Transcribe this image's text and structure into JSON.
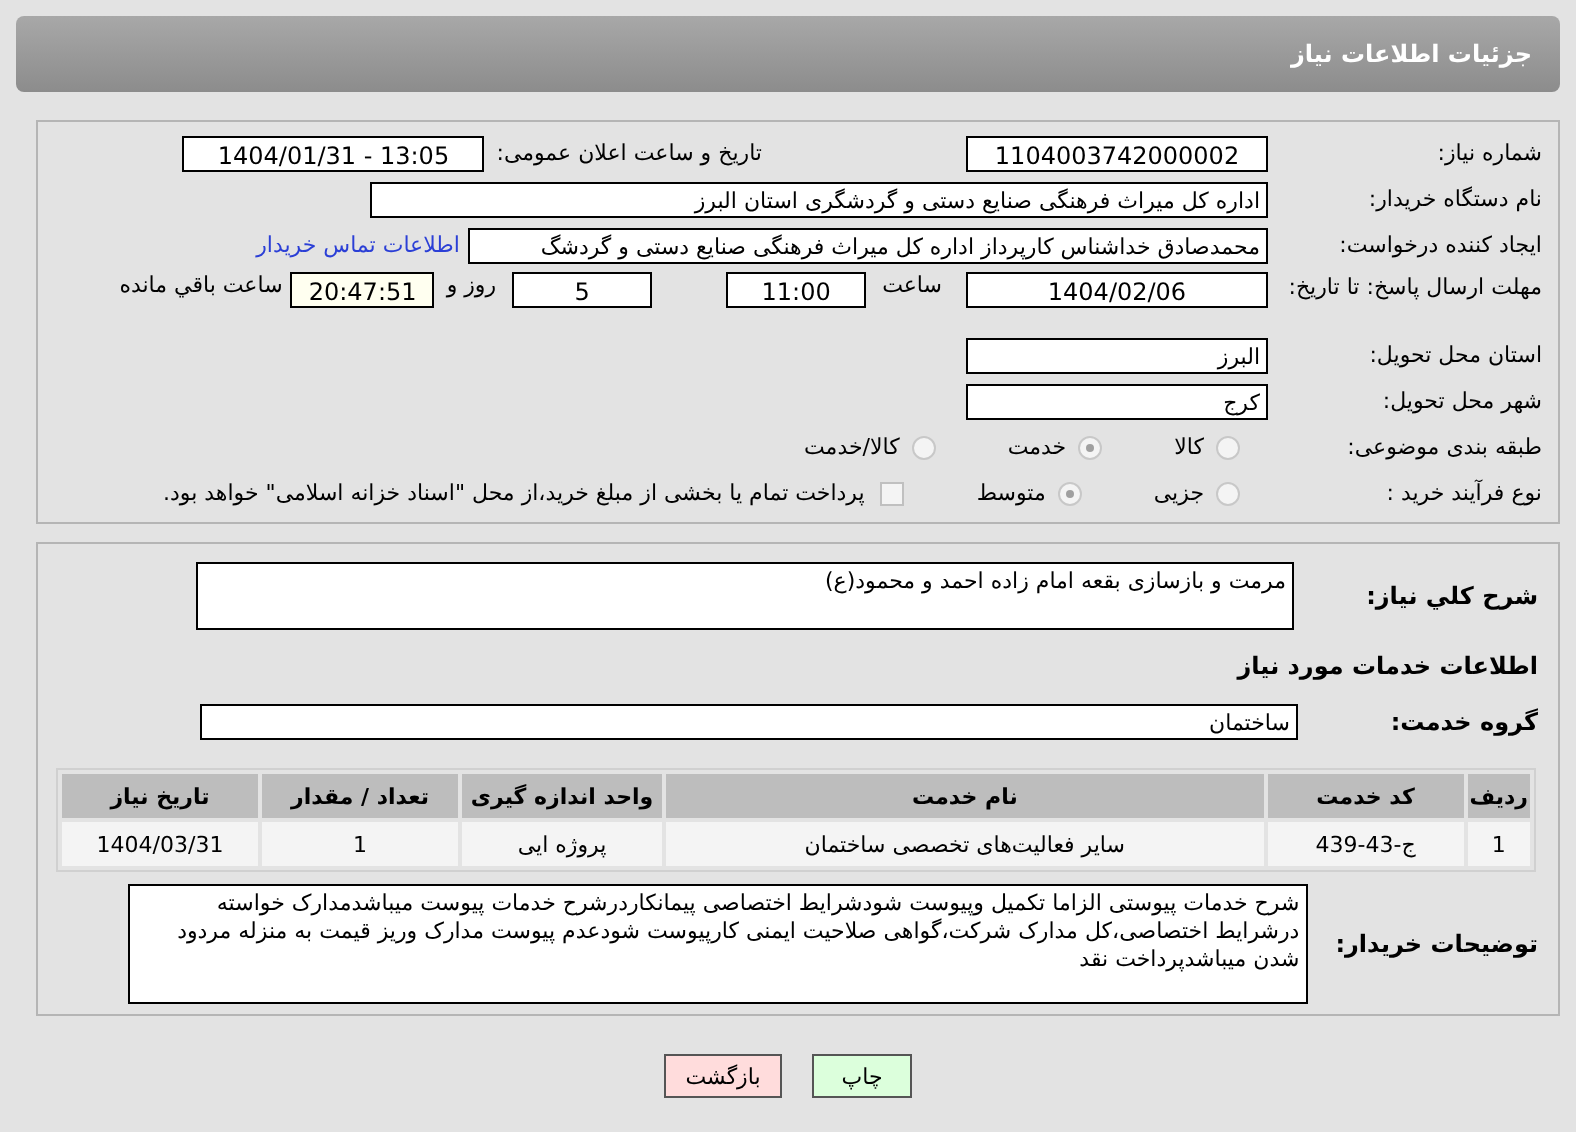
{
  "header": {
    "title": "جزئیات اطلاعات نیاز"
  },
  "details": {
    "need_number": {
      "label": "شماره نیاز:",
      "value": "1104003742000002"
    },
    "announce": {
      "label": "تاریخ و ساعت اعلان عمومی:",
      "value": "1404/01/31 - 13:05"
    },
    "buyer": {
      "label": "نام دستگاه خریدار:",
      "value": "اداره کل میراث فرهنگی  صنایع دستی و گردشگری استان البرز"
    },
    "creator": {
      "label": "ایجاد کننده درخواست:",
      "value": "محمدصادق خداشناس  کارپرداز اداره کل میراث فرهنگی  صنایع دستی و گردشگ",
      "link": "اطلاعات تماس خریدار"
    },
    "deadline": {
      "label": "مهلت ارسال پاسخ: تا تاریخ:",
      "date": "1404/02/06",
      "time_label": "ساعت",
      "time": "11:00",
      "days": "5",
      "days_label": "روز و",
      "remaining": "20:47:51",
      "remaining_label": "ساعت باقي مانده"
    },
    "province": {
      "label": "استان محل تحویل:",
      "value": "البرز"
    },
    "city": {
      "label": "شهر محل تحویل:",
      "value": "کرج"
    },
    "category": {
      "label": "طبقه بندی موضوعی:",
      "options": [
        {
          "label": "کالا",
          "selected": false
        },
        {
          "label": "خدمت",
          "selected": true
        },
        {
          "label": "کالا/خدمت",
          "selected": false
        }
      ]
    },
    "process": {
      "label": "نوع فرآیند خرید :",
      "options": [
        {
          "label": "جزیی",
          "selected": false
        },
        {
          "label": "متوسط",
          "selected": true
        }
      ],
      "payment": {
        "checked": false,
        "text": "پرداخت تمام یا بخشی از مبلغ خرید،از محل \"اسناد خزانه اسلامی\" خواهد بود."
      }
    }
  },
  "services": {
    "summary": {
      "label": "شرح کلي نياز:",
      "value": "مرمت و بازسازی  بقعه امام زاده احمد و محمود(ع)"
    },
    "heading": "اطلاعات خدمات مورد نیاز",
    "group": {
      "label": "گروه خدمت:",
      "value": "ساختمان"
    },
    "table": {
      "columns": [
        "ردیف",
        "کد خدمت",
        "نام خدمت",
        "واحد اندازه گیری",
        "تعداد / مقدار",
        "تاریخ نیاز"
      ],
      "rows": [
        [
          "1",
          "ج-43-439",
          "سایر فعالیت‌های تخصصی ساختمان",
          "پروژه ایی",
          "1",
          "1404/03/31"
        ]
      ]
    },
    "notes": {
      "label": "توضیحات خریدار:",
      "value": "شرح خدمات پیوستی الزاما تکمیل وپیوست شودشرایط اختصاصی پیمانکاردرشرح خدمات پیوست میباشدمدارک خواسته درشرایط اختصاصی،کل مدارک شرکت،گواهی صلاحیت ایمنی کارپیوست شودعدم پیوست مدارک وریز قیمت به منزله مردود شدن میباشدپرداخت نقد"
    }
  },
  "buttons": [
    {
      "label": "چاپ",
      "kind": "print"
    },
    {
      "label": "بازگشت",
      "kind": "back"
    }
  ]
}
